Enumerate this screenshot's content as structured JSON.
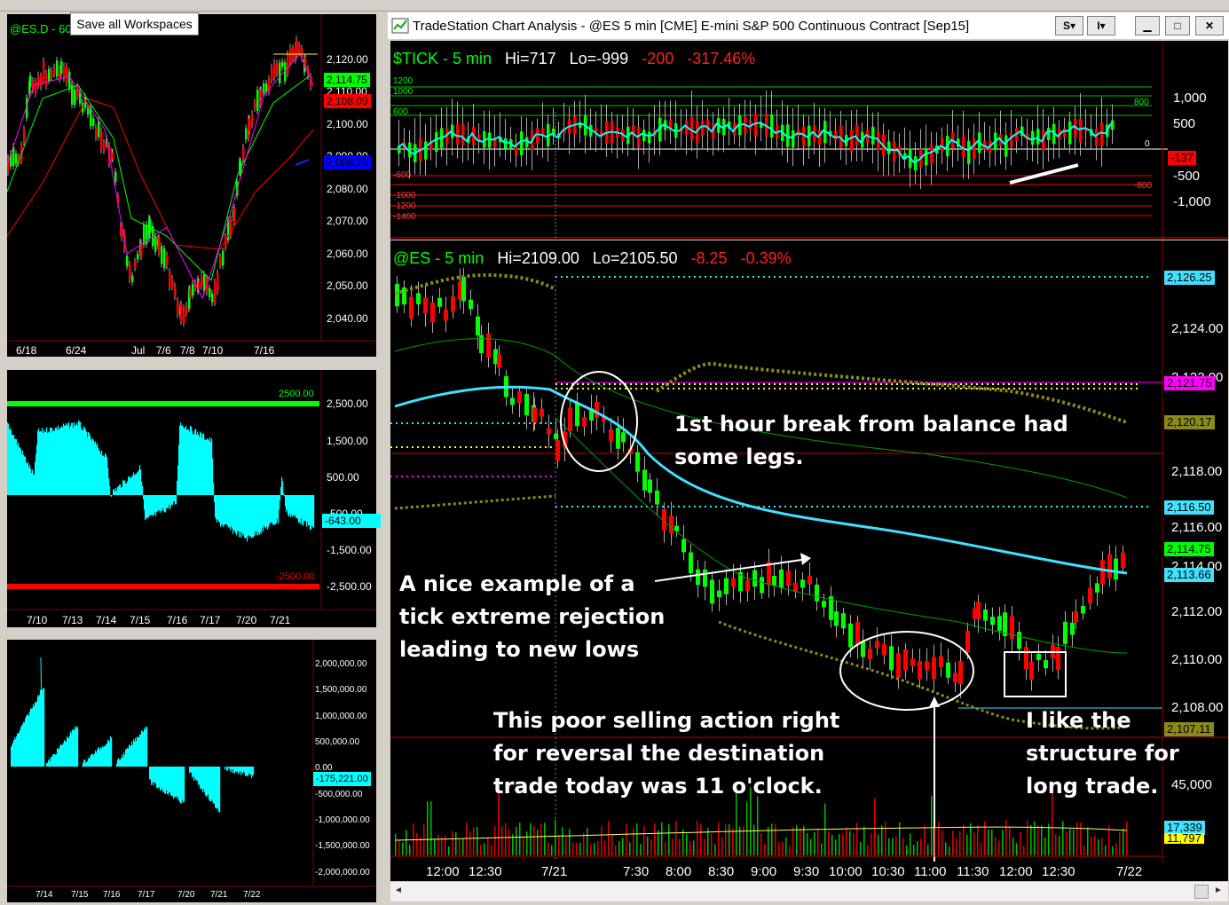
{
  "tooltip": "Save all Workspaces",
  "window": {
    "title": "TradeStation Chart Analysis - @ES 5 min [CME] E-mini S&P 500 Continuous Contract [Sep15]",
    "btn_s": "S",
    "btn_i": "I"
  },
  "left_top": {
    "symbol": "@ES.D - 60",
    "price_labels": [
      "2,120.00",
      "2,110.00",
      "2,100.00",
      "2,090.00",
      "2,080.00",
      "2,070.00",
      "2,060.00",
      "2,050.00",
      "2,040.00"
    ],
    "tag_green": "2,114.75",
    "tag_red": "2,108.09",
    "tag_blue": "2,088.75",
    "date_labels": [
      "6/18",
      "6/24",
      "Jul",
      "7/6",
      "7/8",
      "7/10",
      "7/16"
    ]
  },
  "left_mid": {
    "value_labels": [
      "2,500.00",
      "1,500.00",
      "500.00",
      "-500.00",
      "-1,500.00",
      "-2,500.00"
    ],
    "line_top_label": "2500.00",
    "line_bot_label": "-2500.00",
    "tag_current": "-643.00",
    "date_labels": [
      "7/10",
      "7/13",
      "7/14",
      "7/15",
      "7/16",
      "7/17",
      "7/20",
      "7/21"
    ]
  },
  "left_bot": {
    "value_labels": [
      "2,000,000.00",
      "1,500,000.00",
      "1,000,000.00",
      "500,000.00",
      "0.00",
      "-500,000.00",
      "-1,000,000.00",
      "-1,500,000.00",
      "-2,000,000.00"
    ],
    "tag_current": "-175,221.00",
    "date_labels": [
      "7/14",
      "7/15",
      "7/16",
      "7/17",
      "7/20",
      "7/21",
      "7/22"
    ]
  },
  "tick": {
    "symbol": "$TICK - 5 min",
    "hi": "Hi=717",
    "lo": "Lo=-999",
    "chg": "-200",
    "pct": "-317.46%",
    "level_labels_left": [
      "1200",
      "1000",
      "600",
      "-600",
      "-1000",
      "-1200",
      "-1400"
    ],
    "level_labels_right": [
      "800",
      "0",
      "-800"
    ],
    "axis_labels": [
      "1,000",
      "500",
      "0",
      "-500",
      "-1,000"
    ],
    "tag_current": "-137"
  },
  "es": {
    "symbol": "@ES - 5 min",
    "hi": "Hi=2109.00",
    "lo": "Lo=2105.50",
    "chg": "-8.25",
    "pct": "-0.39%",
    "axis_labels": [
      "2,124.00",
      "2,122.00",
      "2,118.00",
      "2,116.00",
      "2,114.00",
      "2,112.00",
      "2,110.00",
      "2,108.00"
    ],
    "tags": {
      "cyan_top": "2,126.25",
      "magenta": "2,121.75",
      "olive_top": "2,120.17",
      "cyan_mid": "2,116.50",
      "green": "2,114.75",
      "cyan_low": "2,113.66",
      "olive_low": "2,107.11"
    },
    "volume_label": "45,000",
    "vol_tag_cyan": "17,339",
    "vol_tag_yellow": "11,797",
    "time_labels": [
      "12:00",
      "12:30",
      "7/21",
      "7:30",
      "8:00",
      "8:30",
      "9:00",
      "9:30",
      "10:00",
      "10:30",
      "11:00",
      "11:30",
      "12:00",
      "12:30",
      "7/22"
    ]
  },
  "annotations": {
    "a1_l1": "1st hour break from balance had",
    "a1_l2": "some legs.",
    "a2_l1": "A nice example of a",
    "a2_l2": "tick extreme rejection",
    "a2_l3": "leading to new lows",
    "a3_l1": "This poor selling action right",
    "a3_l2": "for reversal the destination",
    "a3_l3": "trade today was 11 o'clock.",
    "a4_l1": "I like the",
    "a4_l2": "structure for",
    "a4_l3": "long trade."
  }
}
